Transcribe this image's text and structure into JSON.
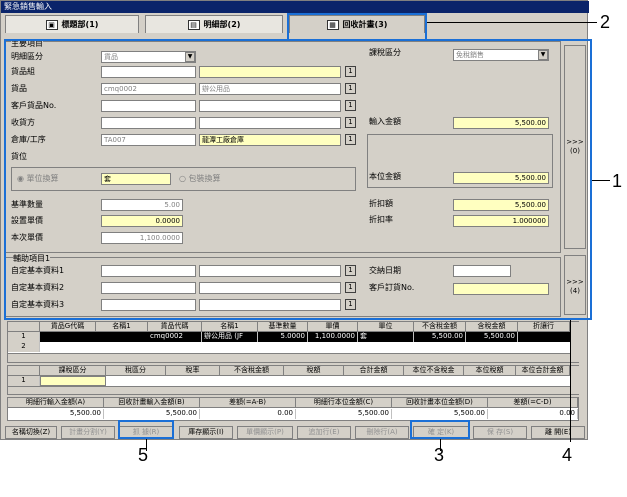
{
  "window": {
    "title": "緊急銷售輸入"
  },
  "tabs": [
    {
      "label": "標題部(1)",
      "icon": "book-icon"
    },
    {
      "label": "明細部(2)",
      "icon": "document-icon"
    },
    {
      "label": "回收計畫(3)",
      "icon": "calendar-icon"
    }
  ],
  "main": {
    "section_label": "主要項目",
    "detail_type_label": "明細區分",
    "detail_type_value": "貨品",
    "goods_group_label": "貨品組",
    "goods_label": "貨品",
    "goods_code": "cmq0002",
    "goods_name": "辦公用品",
    "customer_goods_label": "客戶貨品No.",
    "receiver_label": "收貨方",
    "warehouse_label": "倉庫/工序",
    "warehouse_code": "TA007",
    "warehouse_name": "龍潭工廠倉庫",
    "location_label": "貨位",
    "unit_convert_label": "單位換算",
    "unit_value": "套",
    "package_convert_label": "包裝換算",
    "base_qty_label": "基準數量",
    "base_qty_value": "5.00",
    "set_price_label": "設置單價",
    "set_price_value": "0.0000",
    "current_price_label": "本次單價",
    "current_price_value": "1,100.0000",
    "tax_type_label": "課稅區分",
    "tax_type_value": "免稅銷售",
    "input_amount_label": "輸入金額",
    "input_amount_value": "5,500.00",
    "base_amount_label": "本位金額",
    "base_amount_value": "5,500.00",
    "discount_amount_label": "折扣額",
    "discount_amount_value": "5,500.00",
    "discount_rate_label": "折扣率",
    "discount_rate_value": "1.000000",
    "side_btn_1": ">>> (0)",
    "side_btn_2": ">>> (4)"
  },
  "aux": {
    "section_label": "輔助項目1",
    "custom1_label": "自定基本資料1",
    "custom2_label": "自定基本資料2",
    "custom3_label": "自定基本資料3",
    "delivery_date_label": "交納日期",
    "customer_order_label": "客戶訂貨No.",
    "btn_label": "1"
  },
  "grid1": {
    "headers": [
      "",
      "貨品G代碼",
      "名稱1",
      "貨品代碼",
      "名稱1",
      "基準數量",
      "單價",
      "單位",
      "不含稅金額",
      "含稅金額",
      "折讓行"
    ],
    "rows": [
      [
        "1",
        "",
        "",
        "cmq0002",
        "辦公用品 (JF",
        "5.0000",
        "1,100.0000",
        "套",
        "5,500.00",
        "5,500.00",
        ""
      ],
      [
        "2",
        "",
        "",
        "",
        "",
        "",
        "",
        "",
        "",
        "",
        ""
      ]
    ]
  },
  "grid2": {
    "headers": [
      "",
      "課稅區分",
      "稅區分",
      "稅率",
      "不含稅金額",
      "稅額",
      "合計金額",
      "本位不含稅金",
      "本位稅額",
      "本位合計金額"
    ],
    "rows": [
      [
        "1",
        "",
        "",
        "",
        "",
        "",
        "",
        "",
        "",
        ""
      ]
    ]
  },
  "totals": {
    "headers": [
      "明細行輸入金額(A)",
      "回收計畫輸入金額(B)",
      "差額(=A-B)",
      "明細行本位金額(C)",
      "回收計畫本位金額(D)",
      "差額(=C-D)"
    ],
    "values": [
      "5,500.00",
      "5,500.00",
      "0.00",
      "5,500.00",
      "5,500.00",
      "0.00"
    ]
  },
  "buttons": [
    {
      "label": "名稱切換(Z)",
      "enabled": true
    },
    {
      "label": "計畫分割(Y)",
      "enabled": false
    },
    {
      "label": "抓 據(R)",
      "enabled": false
    },
    {
      "label": "庫存顯示(I)",
      "enabled": true
    },
    {
      "label": "單價顯示(P)",
      "enabled": false
    },
    {
      "label": "追加行(E)",
      "enabled": false
    },
    {
      "label": "刪除行(A)",
      "enabled": false
    },
    {
      "label": "確 定(K)",
      "enabled": false
    },
    {
      "label": "保 存(S)",
      "enabled": false
    },
    {
      "label": "離 開(E)",
      "enabled": true
    }
  ],
  "callouts": [
    "1",
    "2",
    "3",
    "4",
    "5"
  ]
}
